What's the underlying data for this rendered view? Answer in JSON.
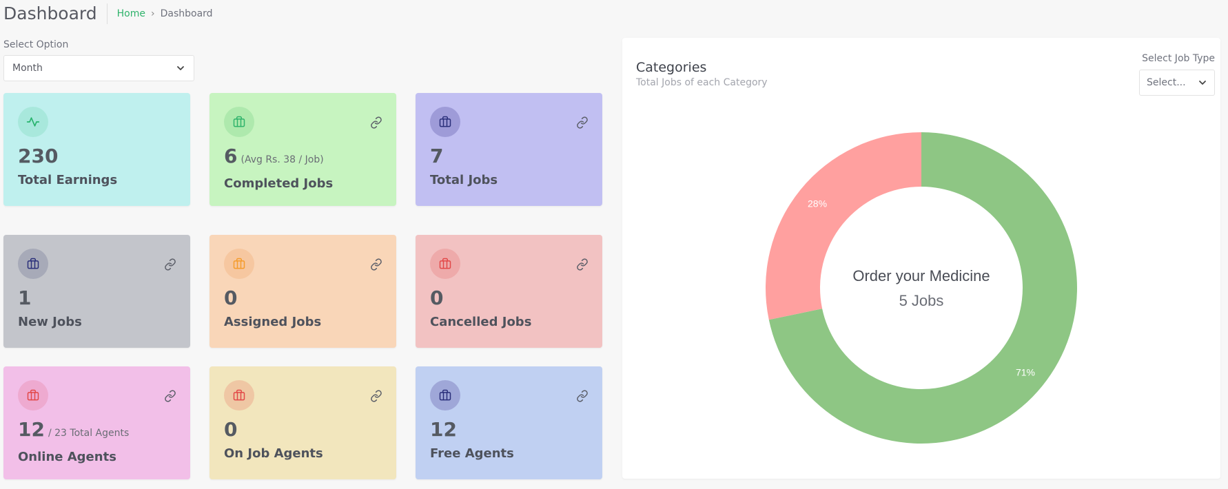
{
  "header": {
    "title": "Dashboard",
    "breadcrumb_home": "Home",
    "breadcrumb_current": "Dashboard"
  },
  "filter": {
    "label": "Select Option",
    "value": "Month"
  },
  "cards": [
    {
      "value": "230",
      "sub": "",
      "label": "Total Earnings",
      "bg": "#bff0ee",
      "icon_bg": "#a8e8dc",
      "icon_color": "#27b36c",
      "icon": "activity-icon",
      "link": false
    },
    {
      "value": "6",
      "sub": "(Avg Rs. 38 / Job)",
      "label": "Completed Jobs",
      "bg": "#c7f4c0",
      "icon_bg": "#aee9ad",
      "icon_color": "#2fb36b",
      "icon": "briefcase-icon",
      "link": true
    },
    {
      "value": "7",
      "sub": "",
      "label": "Total Jobs",
      "bg": "#c1bff2",
      "icon_bg": "#9e9bd8",
      "icon_color": "#2a2f7a",
      "icon": "briefcase-icon",
      "link": true
    },
    {
      "value": "1",
      "sub": "",
      "label": "New Jobs",
      "bg": "#c3c5cb",
      "icon_bg": "#a7aab8",
      "icon_color": "#2a2f7a",
      "icon": "briefcase-icon",
      "link": true
    },
    {
      "value": "0",
      "sub": "",
      "label": "Assigned Jobs",
      "bg": "#f9d6b8",
      "icon_bg": "#f6c7a0",
      "icon_color": "#f59c2c",
      "icon": "briefcase-icon",
      "link": true
    },
    {
      "value": "0",
      "sub": "",
      "label": "Cancelled Jobs",
      "bg": "#f2c2c2",
      "icon_bg": "#eeaaaa",
      "icon_color": "#e24848",
      "icon": "briefcase-icon",
      "link": true
    },
    {
      "value": "12",
      "sub": "/ 23 Total Agents",
      "label": "Online Agents",
      "bg": "#f2bfe8",
      "icon_bg": "#eeaad0",
      "icon_color": "#e24848",
      "icon": "briefcase-icon",
      "link": true
    },
    {
      "value": "0",
      "sub": "",
      "label": "On Job Agents",
      "bg": "#f2e6bd",
      "icon_bg": "#efc7a4",
      "icon_color": "#e24848",
      "icon": "briefcase-icon",
      "link": true
    },
    {
      "value": "12",
      "sub": "",
      "label": "Free Agents",
      "bg": "#c0d0f2",
      "icon_bg": "#9fa7d8",
      "icon_color": "#2a2f7a",
      "icon": "briefcase-icon",
      "link": true
    }
  ],
  "categories_panel": {
    "title": "Categories",
    "subtitle": "Total Jobs of each Category",
    "job_type_label": "Select Job Type",
    "job_type_value": "Select..."
  },
  "chart_data": {
    "type": "pie",
    "donut": true,
    "center_title": "Order your Medicine",
    "center_value": "5 Jobs",
    "slices": [
      {
        "label": "71%",
        "value": 71,
        "color": "#8ec684"
      },
      {
        "label": "28%",
        "value": 28,
        "color": "#ffa09f"
      }
    ]
  }
}
